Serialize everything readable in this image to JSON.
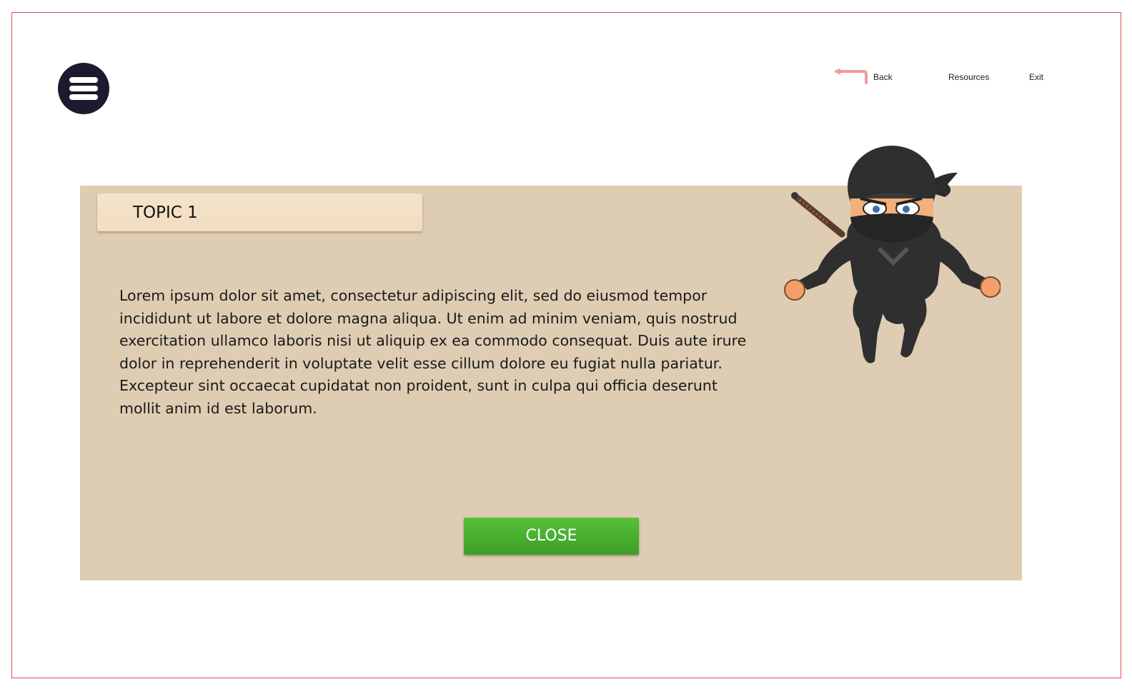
{
  "nav": {
    "back_label": "Back",
    "resources_label": "Resources",
    "exit_label": "Exit"
  },
  "panel": {
    "topic_title": "TOPIC 1",
    "body": "Lorem ipsum dolor sit amet, consectetur adipiscing elit, sed do eiusmod tempor incididunt ut labore et dolore magna aliqua. Ut enim ad minim veniam, quis nostrud exercitation ullamco laboris nisi ut aliquip ex ea commodo consequat. Duis aute irure dolor in reprehenderit in voluptate velit esse cillum dolore eu fugiat nulla pariatur. Excepteur sint occaecat cupidatat non proident, sunt in culpa qui officia deserunt mollit anim id est laborum.",
    "close_label": "CLOSE"
  },
  "icons": {
    "menu": "hamburger-menu-icon",
    "back": "back-arrow-icon",
    "character": "ninja-character"
  },
  "colors": {
    "frame_border": "#d9534f",
    "menu_bg": "#1d1a2f",
    "panel_bg": "#decdb3",
    "tab_bg": "#f4e3cc",
    "close_bg": "#4cb132",
    "back_arrow": "#f08a8a"
  }
}
